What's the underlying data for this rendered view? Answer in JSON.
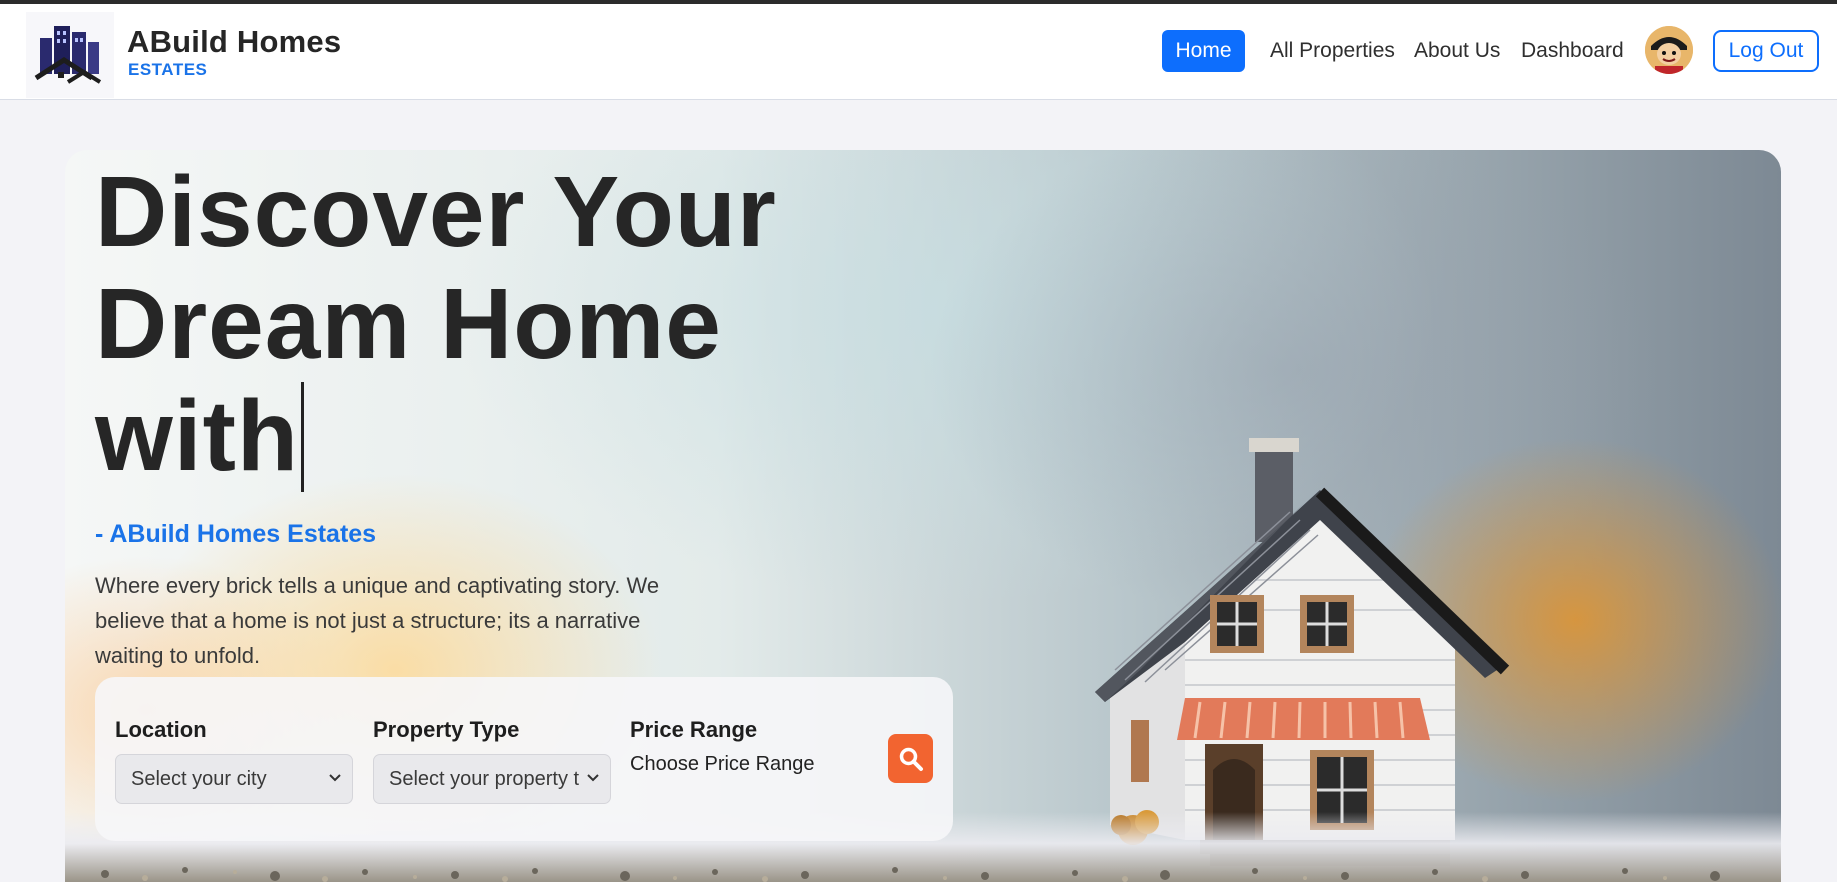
{
  "brand": {
    "name": "ABuild Homes",
    "subtitle": "ESTATES",
    "logo_icon": "buildings-logo-icon"
  },
  "nav": {
    "home": "Home",
    "all_properties": "All Properties",
    "about_us": "About Us",
    "dashboard": "Dashboard",
    "logout": "Log Out",
    "avatar_icon": "user-avatar",
    "active": "Home"
  },
  "hero": {
    "title_line1": "Discover Your",
    "title_line2": "Dream Home",
    "title_line3": "with",
    "tagline": "- ABuild Homes Estates",
    "description": "Where every brick tells a unique and captivating story. We believe that a home is not just a structure; its a narrative waiting to unfold."
  },
  "search": {
    "location_label": "Location",
    "location_value": "Select your city",
    "property_type_label": "Property Type",
    "property_type_value": "Select your property t",
    "price_range_label": "Price Range",
    "price_range_value": "Choose Price Range",
    "search_icon": "search-icon"
  },
  "colors": {
    "primary": "#0d6efd",
    "accent_text": "#1a73e8",
    "search_button": "#f26430"
  }
}
